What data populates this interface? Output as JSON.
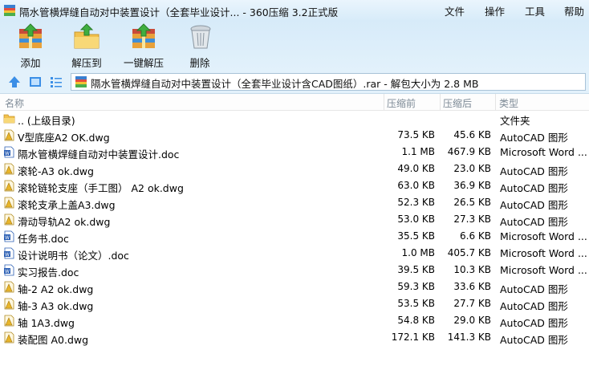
{
  "window": {
    "title": "隔水管横焊缝自动对中装置设计（全套毕业设计... - 360压缩 3.2正式版",
    "menus": [
      "文件",
      "操作",
      "工具",
      "帮助"
    ]
  },
  "toolbar": {
    "add_label": "添加",
    "extract_label": "解压到",
    "oneclick_label": "一键解压",
    "delete_label": "删除"
  },
  "addressbar": {
    "path": "隔水管横焊缝自动对中装置设计（全套毕业设计含CAD图纸）.rar - 解包大小为 2.8 MB"
  },
  "columns": {
    "name": "名称",
    "size": "压缩前",
    "packed": "压缩后",
    "type": "类型"
  },
  "files": [
    {
      "icon": "folder-up-icon",
      "name": ".. (上级目录)",
      "size": "",
      "packed": "",
      "type": "文件夹"
    },
    {
      "icon": "dwg-file-icon",
      "name": "V型底座A2 OK.dwg",
      "size": "73.5 KB",
      "packed": "45.6 KB",
      "type": "AutoCAD 图形"
    },
    {
      "icon": "doc-file-icon",
      "name": "隔水管横焊缝自动对中装置设计.doc",
      "size": "1.1 MB",
      "packed": "467.9 KB",
      "type": "Microsoft Word ..."
    },
    {
      "icon": "dwg-file-icon",
      "name": "滚轮-A3 ok.dwg",
      "size": "49.0 KB",
      "packed": "23.0 KB",
      "type": "AutoCAD 图形"
    },
    {
      "icon": "dwg-file-icon",
      "name": "滚轮链轮支座（手工图）  A2 ok.dwg",
      "size": "63.0 KB",
      "packed": "36.9 KB",
      "type": "AutoCAD 图形"
    },
    {
      "icon": "dwg-file-icon",
      "name": "滚轮支承上盖A3.dwg",
      "size": "52.3 KB",
      "packed": "26.5 KB",
      "type": "AutoCAD 图形"
    },
    {
      "icon": "dwg-file-icon",
      "name": "滑动导轨A2 ok.dwg",
      "size": "53.0 KB",
      "packed": "27.3 KB",
      "type": "AutoCAD 图形"
    },
    {
      "icon": "doc-file-icon",
      "name": "任务书.doc",
      "size": "35.5 KB",
      "packed": "6.6 KB",
      "type": "Microsoft Word ..."
    },
    {
      "icon": "doc-file-icon",
      "name": "设计说明书（论文）.doc",
      "size": "1.0 MB",
      "packed": "405.7 KB",
      "type": "Microsoft Word ..."
    },
    {
      "icon": "doc-file-icon",
      "name": "实习报告.doc",
      "size": "39.5 KB",
      "packed": "10.3 KB",
      "type": "Microsoft Word ..."
    },
    {
      "icon": "dwg-file-icon",
      "name": "轴-2 A2 ok.dwg",
      "size": "59.3 KB",
      "packed": "33.6 KB",
      "type": "AutoCAD 图形"
    },
    {
      "icon": "dwg-file-icon",
      "name": "轴-3 A3 ok.dwg",
      "size": "53.5 KB",
      "packed": "27.7 KB",
      "type": "AutoCAD 图形"
    },
    {
      "icon": "dwg-file-icon",
      "name": "轴   1A3.dwg",
      "size": "54.8 KB",
      "packed": "29.0 KB",
      "type": "AutoCAD 图形"
    },
    {
      "icon": "dwg-file-icon",
      "name": "装配图  A0.dwg",
      "size": "172.1 KB",
      "packed": "141.3 KB",
      "type": "AutoCAD 图形"
    }
  ],
  "colors": {
    "accent": "#3a8ee6",
    "header_text": "#7d8a96",
    "folder": "#f2c14e",
    "dwg": "#e8b52a",
    "doc": "#2b5fb4"
  }
}
